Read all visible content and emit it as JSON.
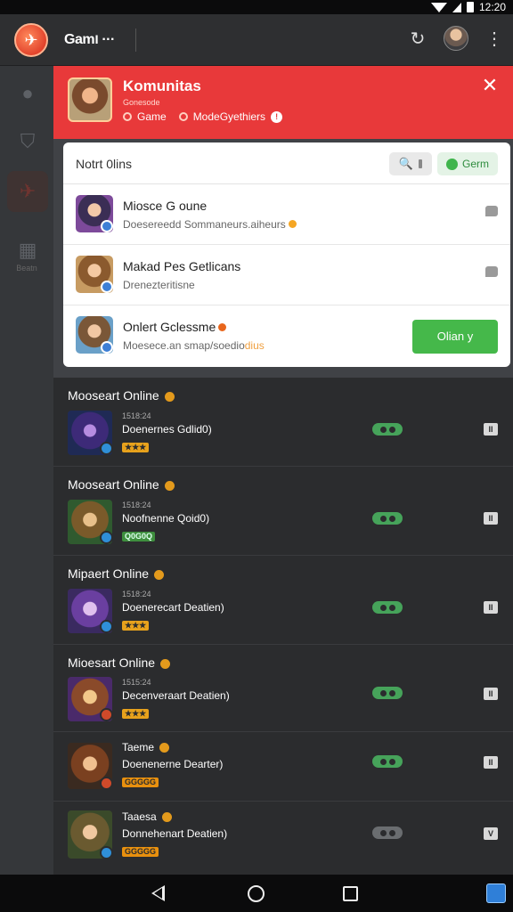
{
  "status": {
    "time": "12:20"
  },
  "app": {
    "title": "Gamו ···"
  },
  "community": {
    "title": "Komunitas",
    "subtitle": "Gonesode",
    "meta_left": "Game",
    "meta_right": "ModeGyethiers",
    "close_icon": "✕"
  },
  "notifications": {
    "title": "Notrt 0lins",
    "search_icon": "🔍",
    "green_label": "Germ",
    "rows": [
      {
        "title": "Miosce G oune",
        "subtitle": "Doesereedd Sommaneurs.aiheurs",
        "action": "comment-icon"
      },
      {
        "title": "Makad Pes Getlicans",
        "subtitle": "Drenezteritisne",
        "action": "comment-icon"
      },
      {
        "title": "Onlert Gclessme",
        "subtitle": "Moesece.an smap/soedio",
        "subtitle_highlight": "dius",
        "button": "Olian y"
      }
    ]
  },
  "servers": [
    {
      "name": "Mooseart Online",
      "count": "1518:24",
      "desc": "Doenernes Gdlid0)",
      "tag": "★★★",
      "tag_color": "orange",
      "online": true,
      "btn": "II"
    },
    {
      "name": "Mooseart Online",
      "count": "1518:24",
      "desc": "Noofnenne Qoid0)",
      "tag": "Q0G0Q",
      "tag_color": "green",
      "online": true,
      "btn": "II"
    },
    {
      "name": "Mipaert Online",
      "count": "1518:24",
      "desc": "Doenerecart Deatien)",
      "tag": "★★★",
      "tag_color": "orange",
      "online": true,
      "btn": "II"
    },
    {
      "name": "Mioesart Online",
      "count": "1515:24",
      "desc": "Decenveraart Deatien)",
      "tag": "★★★",
      "tag_color": "orange",
      "online": true,
      "btn": "II"
    },
    {
      "name": "Taeme",
      "count": "",
      "desc": "Doenenerne Dearter)",
      "tag": "GGGGG",
      "tag_color": "orange",
      "online": true,
      "btn": "II"
    },
    {
      "name": "Taaesa",
      "count": "",
      "desc": "Donnehenart Deatien)",
      "tag": "GGGGG",
      "tag_color": "orange",
      "online": false,
      "btn": "V"
    }
  ],
  "rail": {
    "bottom_label": "Beatn"
  }
}
